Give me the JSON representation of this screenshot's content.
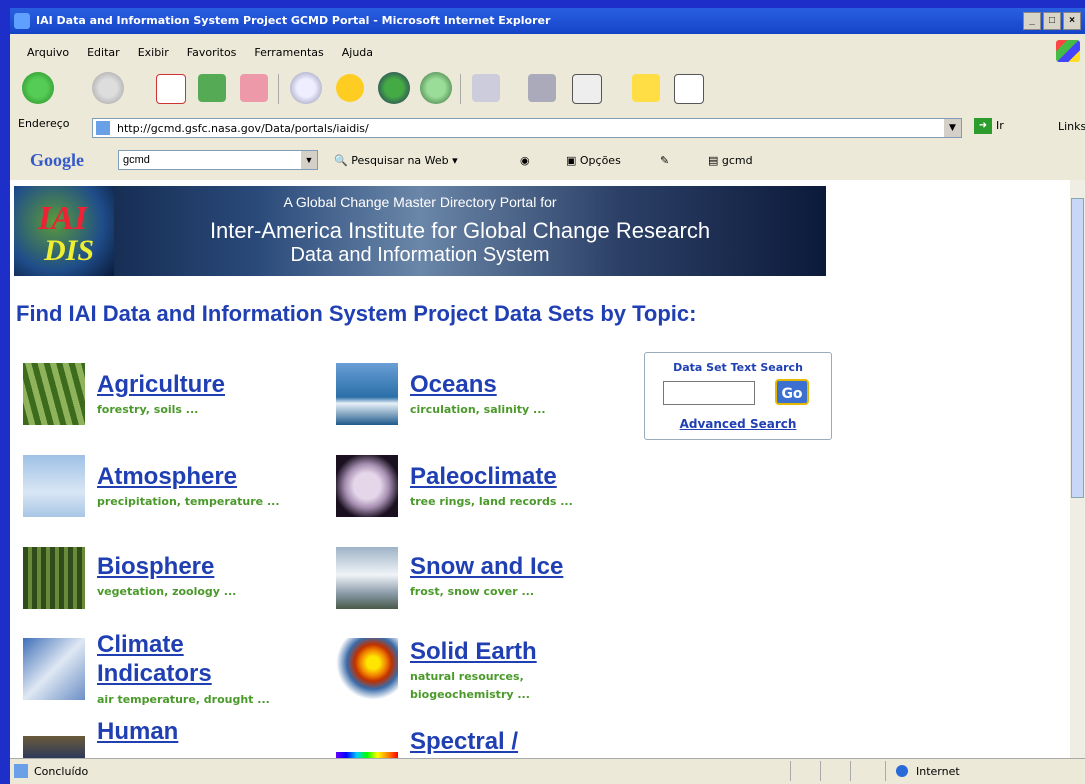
{
  "window": {
    "title": "IAI Data and Information System Project GCMD Portal - Microsoft Internet Explorer"
  },
  "menu": [
    "Arquivo",
    "Editar",
    "Exibir",
    "Favoritos",
    "Ferramentas",
    "Ajuda"
  ],
  "address": {
    "label": "Endereço",
    "url": "http://gcmd.gsfc.nasa.gov/Data/portals/iaidis/",
    "go": "Ir",
    "links": "Links"
  },
  "google": {
    "logo": "Google",
    "query": "gcmd",
    "search_web": "Pesquisar na Web",
    "options": "Opções",
    "gcmd": "gcmd"
  },
  "banner": {
    "logo_top": "IAI",
    "logo_bottom": "DIS",
    "line1": "A Global Change Master Directory Portal for",
    "line2": "Inter-America Institute for Global Change Research",
    "line3": "Data and Information System"
  },
  "heading": "Find IAI Data and Information System Project Data Sets by Topic:",
  "topics": [
    {
      "name": "Agriculture",
      "sub": "forestry, soils ..."
    },
    {
      "name": "Atmosphere",
      "sub": "precipitation, temperature ..."
    },
    {
      "name": "Biosphere",
      "sub": "vegetation, zoology ..."
    },
    {
      "name": "Climate",
      "name2": "Indicators",
      "sub": "air temperature, drought ..."
    },
    {
      "name": "Human"
    },
    {
      "name": "Oceans",
      "sub": "circulation, salinity ..."
    },
    {
      "name": "Paleoclimate",
      "sub": "tree rings, land records ..."
    },
    {
      "name": "Snow and Ice",
      "sub": "frost, snow cover ..."
    },
    {
      "name": "Solid Earth",
      "sub": "natural resources,",
      "sub2": "biogeochemistry ..."
    },
    {
      "name": "Spectral /"
    }
  ],
  "search": {
    "title": "Data Set Text Search",
    "go": "Go",
    "advanced": "Advanced Search"
  },
  "status": {
    "left": "Concluído",
    "zone": "Internet"
  }
}
